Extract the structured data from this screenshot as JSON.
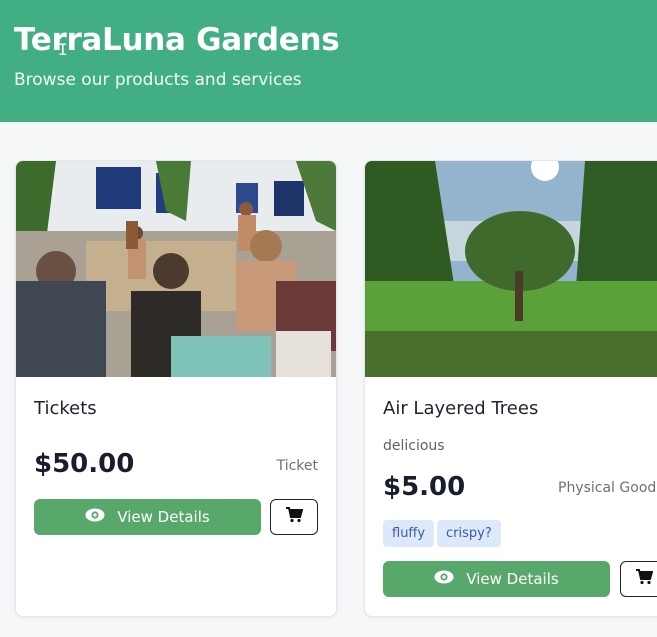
{
  "header": {
    "title": "TerraLuna Gardens",
    "subtitle": "Browse our products and services"
  },
  "products": [
    {
      "image": "drum-circle-photo",
      "title": "Tickets",
      "description": "",
      "price": "$50.00",
      "type": "Ticket",
      "tags": [],
      "view_label": "View Details"
    },
    {
      "image": "trees-landscape-photo",
      "title": "Air Layered Trees",
      "description": "delicious",
      "price": "$5.00",
      "type": "Physical Good",
      "tags": [
        "fluffy",
        "crispy?"
      ],
      "view_label": "View Details"
    }
  ],
  "icons": {
    "view": "eye-icon",
    "cart": "cart-icon"
  },
  "colors": {
    "header_bg": "#42ae84",
    "button_bg": "#58a86b",
    "tag_bg": "#dde8fb",
    "tag_text": "#3a5ba8"
  }
}
